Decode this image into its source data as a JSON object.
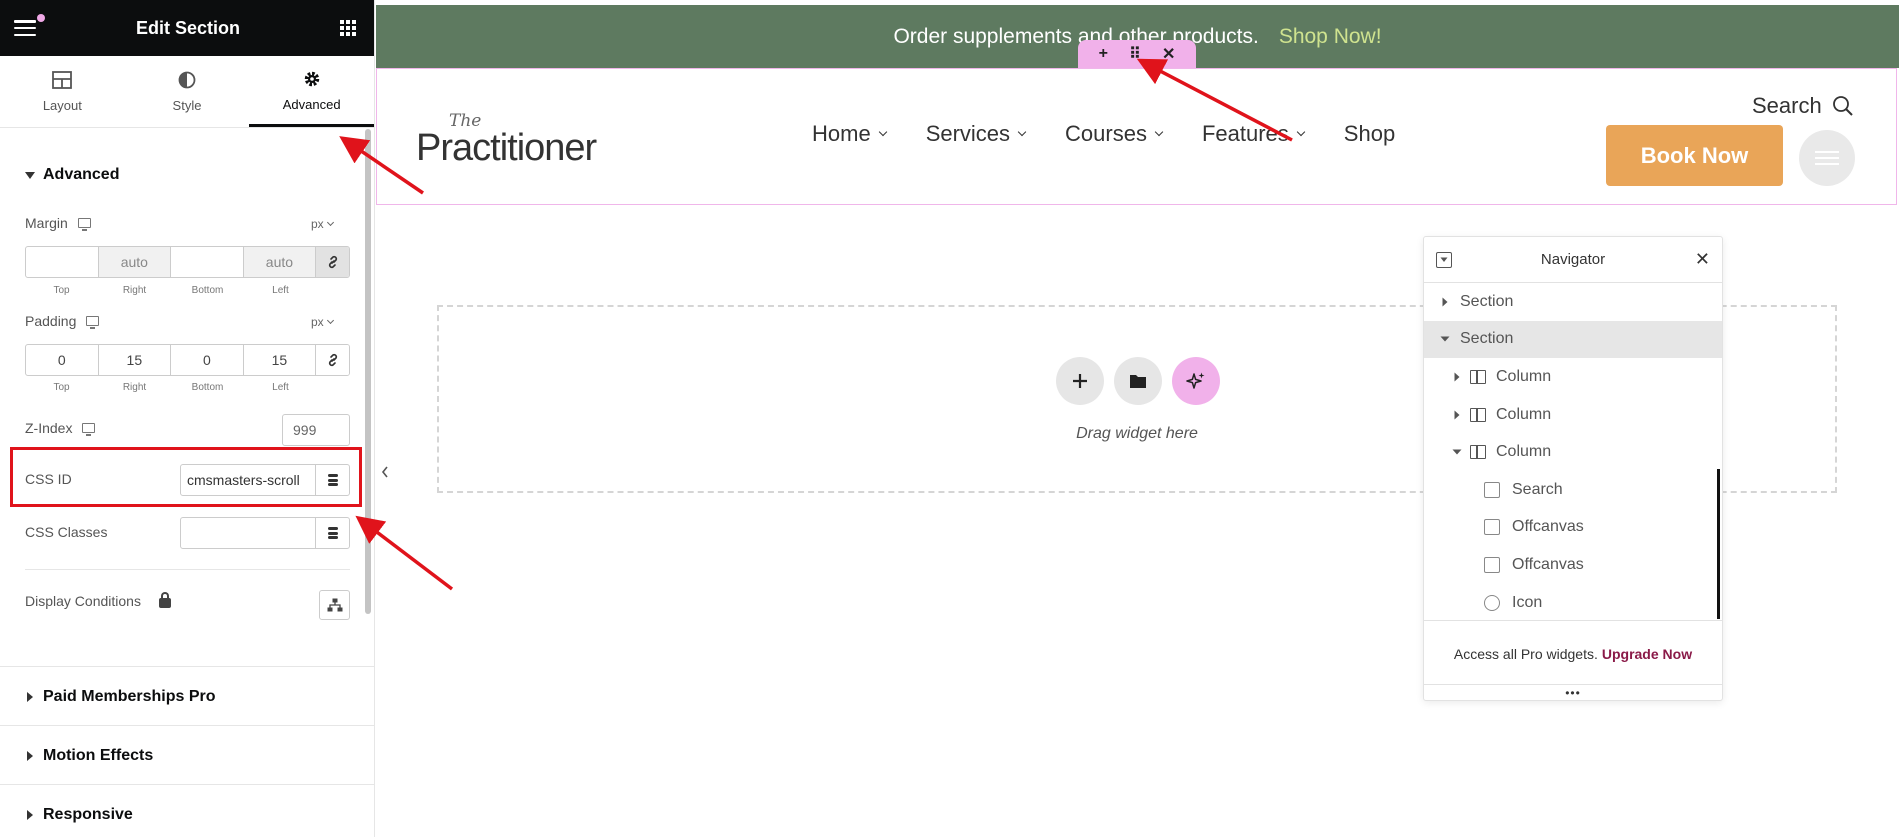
{
  "panel": {
    "title": "Edit Section",
    "tabs": [
      {
        "label": "Layout"
      },
      {
        "label": "Style"
      },
      {
        "label": "Advanced"
      }
    ],
    "section_title": "Advanced",
    "margin": {
      "label": "Margin",
      "unit": "px",
      "values": {
        "top": "",
        "right": "auto",
        "bottom": "",
        "left": "auto"
      },
      "sublabels": [
        "Top",
        "Right",
        "Bottom",
        "Left"
      ]
    },
    "padding": {
      "label": "Padding",
      "unit": "px",
      "values": {
        "top": "0",
        "right": "15",
        "bottom": "0",
        "left": "15"
      },
      "sublabels": [
        "Top",
        "Right",
        "Bottom",
        "Left"
      ]
    },
    "zindex": {
      "label": "Z-Index",
      "value": "999"
    },
    "css_id": {
      "label": "CSS ID",
      "value": "cmsmasters-scroll"
    },
    "css_classes": {
      "label": "CSS Classes",
      "value": ""
    },
    "display_conditions": {
      "label": "Display Conditions"
    },
    "accordions": [
      "Paid Memberships Pro",
      "Motion Effects",
      "Responsive"
    ]
  },
  "site": {
    "promo_text": "Order supplements and other products.",
    "promo_link": "Shop Now!",
    "logo_the": "The",
    "logo_name": "Practitioner",
    "nav": [
      {
        "label": "Home",
        "dropdown": true
      },
      {
        "label": "Services",
        "dropdown": true
      },
      {
        "label": "Courses",
        "dropdown": true
      },
      {
        "label": "Features",
        "dropdown": true
      },
      {
        "label": "Shop",
        "dropdown": false
      }
    ],
    "search_label": "Search",
    "book_label": "Book Now",
    "handle": {
      "add": "+",
      "move": "⠿",
      "close": "✕"
    },
    "dropzone_text": "Drag widget here"
  },
  "navigator": {
    "title": "Navigator",
    "items": [
      {
        "label": "Section",
        "indent": 0,
        "arrow": "right",
        "icon": "none"
      },
      {
        "label": "Section",
        "indent": 0,
        "arrow": "down",
        "icon": "none",
        "selected": true
      },
      {
        "label": "Column",
        "indent": 1,
        "arrow": "right",
        "icon": "column"
      },
      {
        "label": "Column",
        "indent": 1,
        "arrow": "right",
        "icon": "column"
      },
      {
        "label": "Column",
        "indent": 1,
        "arrow": "down",
        "icon": "column"
      },
      {
        "label": "Search",
        "indent": 2,
        "arrow": "none",
        "icon": "search"
      },
      {
        "label": "Offcanvas",
        "indent": 2,
        "arrow": "none",
        "icon": "offcanvas"
      },
      {
        "label": "Offcanvas",
        "indent": 2,
        "arrow": "none",
        "icon": "offcanvas"
      },
      {
        "label": "Icon",
        "indent": 2,
        "arrow": "none",
        "icon": "icon"
      }
    ],
    "footer_text": "Access all Pro widgets.",
    "footer_link": "Upgrade Now",
    "resize_glyph": "•••"
  },
  "colors": {
    "panel_header": "#0c0d0e",
    "promo_bg": "#5e7a60",
    "promo_link": "#cfe38f",
    "book_button": "#e9a558",
    "handle": "#f1b1ea",
    "annotation_red": "#e0131b",
    "upgrade_link": "#8a1a48"
  }
}
